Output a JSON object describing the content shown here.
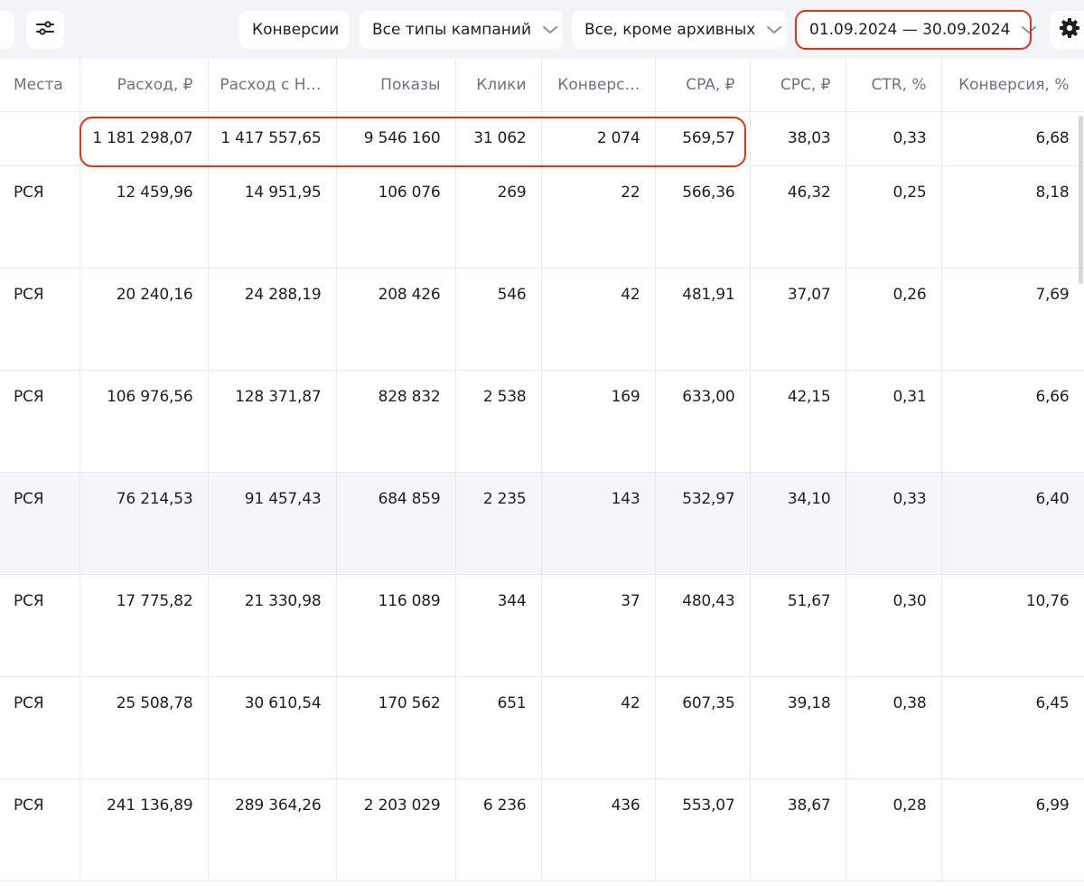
{
  "toolbar": {
    "conversions_label": "Конверсии",
    "campaign_types_label": "Все типы кампаний",
    "archive_filter_label": "Все, кроме архивных",
    "date_range_label": "01.09.2024 — 30.09.2024"
  },
  "table": {
    "columns": [
      "Места",
      "Расход, ₽",
      "Расход с Н…",
      "Показы",
      "Клики",
      "Конверс…",
      "CPA, ₽",
      "CPC, ₽",
      "CTR, %",
      "Конверсия, %"
    ],
    "totals": [
      "",
      "1 181 298,07",
      "1 417 557,65",
      "9 546 160",
      "31 062",
      "2 074",
      "569,57",
      "38,03",
      "0,33",
      "6,68"
    ],
    "rows": [
      [
        "РСЯ",
        "12 459,96",
        "14 951,95",
        "106 076",
        "269",
        "22",
        "566,36",
        "46,32",
        "0,25",
        "8,18"
      ],
      [
        "РСЯ",
        "20 240,16",
        "24 288,19",
        "208 426",
        "546",
        "42",
        "481,91",
        "37,07",
        "0,26",
        "7,69"
      ],
      [
        "РСЯ",
        "106 976,56",
        "128 371,87",
        "828 832",
        "2 538",
        "169",
        "633,00",
        "42,15",
        "0,31",
        "6,66"
      ],
      [
        "РСЯ",
        "76 214,53",
        "91 457,43",
        "684 859",
        "2 235",
        "143",
        "532,97",
        "34,10",
        "0,33",
        "6,40"
      ],
      [
        "РСЯ",
        "17 775,82",
        "21 330,98",
        "116 089",
        "344",
        "37",
        "480,43",
        "51,67",
        "0,30",
        "10,76"
      ],
      [
        "РСЯ",
        "25 508,78",
        "30 610,54",
        "170 562",
        "651",
        "42",
        "607,35",
        "39,18",
        "0,38",
        "6,45"
      ],
      [
        "РСЯ",
        "241 136,89",
        "289 364,26",
        "2 203 029",
        "6 236",
        "436",
        "553,07",
        "38,67",
        "0,28",
        "6,99"
      ]
    ]
  },
  "colors": {
    "highlight": "#e0321d",
    "toolbar_bg": "#f3f4f8",
    "header_text": "#6e7385",
    "row_hover_bg": "#f5f6fa"
  },
  "icons": {
    "filter": "sliders-icon",
    "chevron": "chevron-down-icon",
    "settings": "gear-icon"
  }
}
